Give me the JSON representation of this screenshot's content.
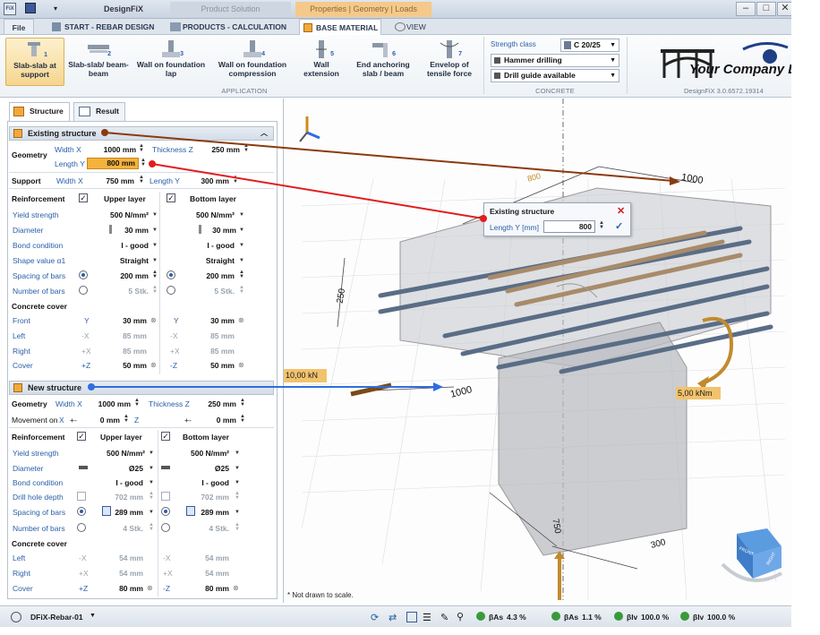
{
  "app": {
    "title": "DesignFiX",
    "logo_icon": "fix-logo-icon",
    "context_tabs": [
      "Product Solution",
      "Properties | Geometry | Loads"
    ]
  },
  "menu_tabs": [
    {
      "label": "File"
    },
    {
      "label": "START - REBAR DESIGN"
    },
    {
      "label": "PRODUCTS - CALCULATION"
    },
    {
      "label": "BASE MATERIAL"
    },
    {
      "label": "VIEW"
    }
  ],
  "ribbon": {
    "buttons": [
      {
        "label": "Slab-slab at support",
        "num": "1"
      },
      {
        "label": "Slab-slab/ beam-beam",
        "num": "2"
      },
      {
        "label": "Wall on foundation lap",
        "num": "3"
      },
      {
        "label": "Wall on foundation compression",
        "num": "4"
      },
      {
        "label": "Wall extension",
        "num": "5"
      },
      {
        "label": "End anchoring slab / beam",
        "num": "6"
      },
      {
        "label": "Envelop of tensile force",
        "num": "7"
      }
    ],
    "group_application": "APPLICATION",
    "strength_class_label": "Strength class",
    "strength_class_value": "C 20/25",
    "drilling_value": "Hammer drilling",
    "drill_guide_value": "Drill guide available",
    "group_concrete": "CONCRETE",
    "company_logo": "Your Company Logo",
    "version": "DesignFiX 3.0.6572.19314"
  },
  "panel_tabs": {
    "structure": "Structure",
    "result": "Result"
  },
  "existing": {
    "title": "Existing structure",
    "geometry": "Geometry",
    "width_x_label": "Width X",
    "width_x": "1000 mm",
    "thickness_z_label": "Thickness Z",
    "thickness_z": "250 mm",
    "length_y_label": "Length Y",
    "length_y": "800 mm",
    "support": "Support",
    "s_width_x": "750 mm",
    "s_length_y": "300 mm",
    "reinforcement": "Reinforcement",
    "upper_layer": "Upper layer",
    "bottom_layer": "Bottom layer",
    "rows": [
      {
        "label": "Yield strength",
        "upper": "500 N/mm²",
        "bottom": "500 N/mm²"
      },
      {
        "label": "Diameter",
        "upper": "30 mm",
        "bottom": "30 mm"
      },
      {
        "label": "Bond condition",
        "upper": "I - good",
        "bottom": "I - good"
      },
      {
        "label": "Shape value α1",
        "upper": "Straight",
        "bottom": "Straight"
      },
      {
        "label": "Spacing of bars",
        "upper": "200 mm",
        "bottom": "200 mm"
      },
      {
        "label": "Number of bars",
        "upper": "5 Stk.",
        "bottom": "5 Stk."
      }
    ],
    "concrete_cover": "Concrete cover",
    "cover_rows": [
      {
        "label": "Front",
        "ax1": "Y",
        "v1": "30 mm",
        "ax2": "Y",
        "v2": "30 mm"
      },
      {
        "label": "Left",
        "ax1": "-X",
        "v1": "85 mm",
        "ax2": "-X",
        "v2": "85 mm"
      },
      {
        "label": "Right",
        "ax1": "+X",
        "v1": "85 mm",
        "ax2": "+X",
        "v2": "85 mm"
      },
      {
        "label": "Cover",
        "ax1": "+Z",
        "v1": "50 mm",
        "ax2": "-Z",
        "v2": "50 mm"
      }
    ]
  },
  "newstruct": {
    "title": "New structure",
    "geometry": "Geometry",
    "width_x_label": "Width X",
    "width_x": "1000 mm",
    "thickness_z_label": "Thickness Z",
    "thickness_z": "250 mm",
    "movement_label": "Movement on",
    "mx": "X",
    "mx_sign": "+-",
    "mx_val": "0 mm",
    "mz": "Z",
    "mz_sign": "+-",
    "mz_val": "0 mm",
    "reinforcement": "Reinforcement",
    "upper_layer": "Upper layer",
    "bottom_layer": "Bottom layer",
    "rows": [
      {
        "label": "Yield strength",
        "upper": "500 N/mm²",
        "bottom": "500 N/mm²"
      },
      {
        "label": "Diameter",
        "upper": "Ø25",
        "bottom": "Ø25"
      },
      {
        "label": "Bond condition",
        "upper": "I - good",
        "bottom": "I - good"
      },
      {
        "label": "Drill hole depth",
        "upper": "702 mm",
        "bottom": "702 mm"
      },
      {
        "label": "Spacing of bars",
        "upper": "289 mm",
        "bottom": "289 mm"
      },
      {
        "label": "Number of bars",
        "upper": "4 Stk.",
        "bottom": "4 Stk."
      }
    ],
    "concrete_cover": "Concrete cover",
    "cover_rows": [
      {
        "label": "Left",
        "ax1": "-X",
        "v1": "54 mm",
        "ax2": "-X",
        "v2": "54 mm"
      },
      {
        "label": "Right",
        "ax1": "+X",
        "v1": "54 mm",
        "ax2": "+X",
        "v2": "54 mm"
      },
      {
        "label": "Cover",
        "ax1": "+Z",
        "v1": "80 mm",
        "ax2": "-Z",
        "v2": "80 mm"
      }
    ]
  },
  "viewport": {
    "popup_title": "Existing structure",
    "popup_label": "Length Y [mm]",
    "popup_value": "800",
    "dim_800": "800",
    "dim_1000_top": "1000",
    "dim_250": "250",
    "dim_1000_bot": "1000",
    "dim_750": "750",
    "dim_300": "300",
    "force": "10,00 kN",
    "moment": "5,00 kNm",
    "note": "* Not drawn to scale.",
    "nav_front": "FRONT",
    "nav_right": "RIGHT"
  },
  "status": {
    "project": "DFiX-Rebar-01",
    "items": [
      {
        "label": "βAs",
        "value": "4.3 %"
      },
      {
        "label": "βAs",
        "value": "1.1 %"
      },
      {
        "label": "βlv",
        "value": "100.0 %"
      },
      {
        "label": "βlv",
        "value": "100.0 %"
      }
    ]
  },
  "colors": {
    "accent_orange": "#f2a93b",
    "link_blue": "#2a5fa8",
    "arrow_red": "#e11d1d",
    "arrow_brown": "#8b3a0f",
    "arrow_blue": "#2f6de0"
  }
}
